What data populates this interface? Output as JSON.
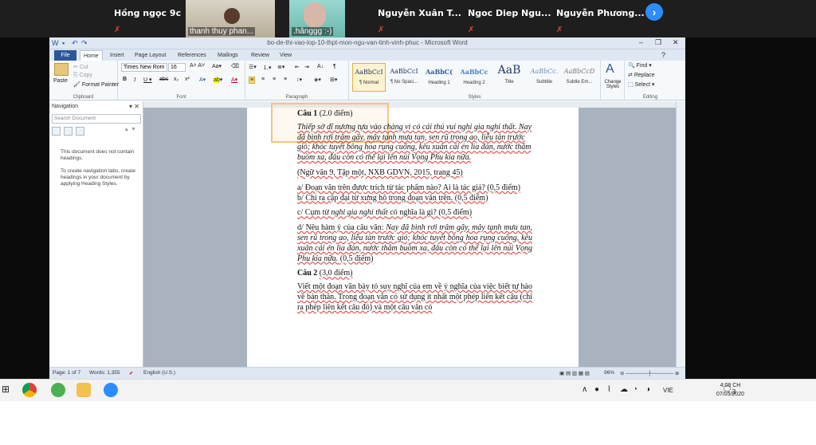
{
  "zoom": {
    "participants": [
      {
        "name": "Hồng ngọc 9c"
      },
      {
        "name": "thanh thuy phan..."
      },
      {
        "name": ".hânggg :-)"
      },
      {
        "name": "Nguyễn Xuân T..."
      },
      {
        "name": "Ngoc Diep Ngu..."
      },
      {
        "name": "Nguyễn Phương..."
      }
    ],
    "next_label": "›"
  },
  "word": {
    "title": "bo-de-thi-vao-lop-10-thpt-mon-ngu-van-tinh-vinh-phuc - Microsoft Word",
    "tabs": [
      "File",
      "Home",
      "Insert",
      "Page Layout",
      "References",
      "Mailings",
      "Review",
      "View"
    ],
    "active_tab": "Home",
    "clipboard": {
      "paste": "Paste",
      "cut": "Cut",
      "copy": "Copy",
      "format_painter": "Format Painter",
      "label": "Clipboard"
    },
    "font": {
      "name": "Times New Rom",
      "size": "16",
      "label": "Font"
    },
    "paragraph": {
      "label": "Paragraph"
    },
    "styles": {
      "label": "Styles",
      "items": [
        {
          "preview": "AaBbCcI",
          "name": "¶ Normal"
        },
        {
          "preview": "AaBbCcI",
          "name": "¶ No Spaci..."
        },
        {
          "preview": "AaBbC(",
          "name": "Heading 1"
        },
        {
          "preview": "AaBbCc",
          "name": "Heading 2"
        },
        {
          "preview": "AaB",
          "name": "Title"
        },
        {
          "preview": "AaBbCc.",
          "name": "Subtitle"
        },
        {
          "preview": "AaBbCcD",
          "name": "Subtle Em..."
        }
      ],
      "change": "Change Styles"
    },
    "editing": {
      "find": "Find",
      "replace": "Replace",
      "select": "Select",
      "label": "Editing"
    },
    "nav": {
      "title": "Navigation",
      "search_placeholder": "Search Document",
      "msg1": "This document does not contain headings.",
      "msg2": "To create navigation tabs, create headings in your document by applying Heading Styles."
    },
    "status": {
      "page": "Page: 1 of 7",
      "words": "Words: 1,355",
      "lang": "English (U.S.)",
      "zoom": "96%"
    }
  },
  "doc": {
    "q1_title": "Câu 1",
    "q1_points": "(2.0 điểm)",
    "passage": "Thiếp sở dĩ nương tựa vào chàng vì có cái thú vui nghi gia nghi thất. Nay đã bình rơi trâm gãy, mây tạnh mưa tan, sen rũ trong ao, liễu tàn trước gió; khóc tuyết bông hoa rụng cuống, kêu xuân cái én lìa đàn, nước thẳm buồm xa, đâu còn có thể lại lên núi Vọng Phu kia nữa.",
    "source": "(Ngữ văn 9, Tập một, NXB GDVN, 2015, trang 45)",
    "qa": "a/ Đoạn văn trên được trích từ tác phẩm nào? Ai là tác giả? (0,5 điểm)",
    "qb": "b/ Chỉ ra cặp đại từ xưng hô trong đoạn văn trên. (0,5 điểm)",
    "qc_pre": "c/ Cụm từ ",
    "qc_it": "nghi gia nghi thất",
    "qc_post": " có nghĩa là gì? (0,5 điểm)",
    "qd_pre": "d/ Nêu hàm ý của câu văn: ",
    "qd_it": "Nay đã bình rơi trâm gãy, mây tạnh mưa tan, sen rũ trong ao, liễu tàn trước gió; khóc tuyết bông hoa rụng cuống, kêu xuân cái én lìa đàn, nước thẳm buồm xa, đâu còn có thể lại lên núi Vọng Phu kia nữa.",
    "qd_post": " (0,5 điểm)",
    "q2_title": "Câu 2",
    "q2_points": "(3,0 điểm)",
    "q2_text": "Viết một đoạn văn bày tỏ suy nghĩ của em về ý nghĩa của việc biết tự hào về bản thân. Trong đoạn văn có sử dụng ít nhất một phép liên kết câu (chỉ ra phép liên kết câu đó) và một câu văn có"
  },
  "taskbar": {
    "lang": "VIE",
    "time": "4:08 CH",
    "date": "07/05/2020",
    "notif": "3"
  }
}
